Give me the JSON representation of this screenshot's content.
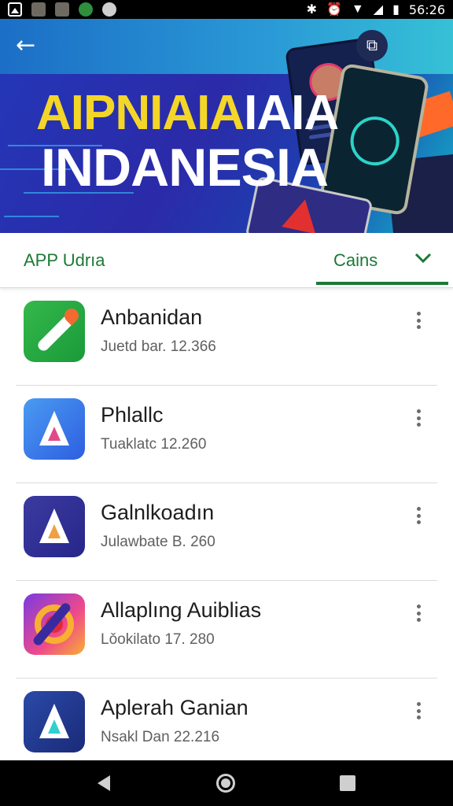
{
  "status_bar": {
    "time": "56:26",
    "left_icons": [
      "gallery-icon",
      "photo-icon",
      "photo2-icon",
      "maps-icon",
      "settings-icon"
    ],
    "right_icons": [
      "bluetooth-icon",
      "alarm-icon",
      "wifi-icon",
      "signal-icon",
      "battery-icon"
    ]
  },
  "hero": {
    "back_icon": "back-arrow-icon",
    "share_icon": "share-icon",
    "title_line1_yellow": "AIPNIAIA",
    "title_line1_white": "IAIA",
    "title_line2": "INDANESIA"
  },
  "filter": {
    "title": "APP Udrıa",
    "sort_label": "Cains",
    "sort_icon": "chevron-down-icon",
    "accent_color": "#1b7a36"
  },
  "apps": [
    {
      "name": "Anbanidan",
      "subtitle": "Juetd bar. 12.366",
      "icon": "rocket-app-icon"
    },
    {
      "name": "Phlallc",
      "subtitle": "Tuaklatc 12.260",
      "icon": "a-logo-blue-icon"
    },
    {
      "name": "Galnlkoadın",
      "subtitle": "Julawbate B. 260",
      "icon": "a-logo-navy-icon"
    },
    {
      "name": "Allaplıng Auiblias",
      "subtitle": "Lǒokilato 17. 280",
      "icon": "target-app-icon"
    },
    {
      "name": "Aplerah Ganian",
      "subtitle": "Nsakl Dan 22.216",
      "icon": "a-logo-dark-icon"
    }
  ],
  "nav_bar": {
    "back_icon": "nav-back-icon",
    "home_icon": "nav-home-icon",
    "recents_icon": "nav-recents-icon"
  }
}
